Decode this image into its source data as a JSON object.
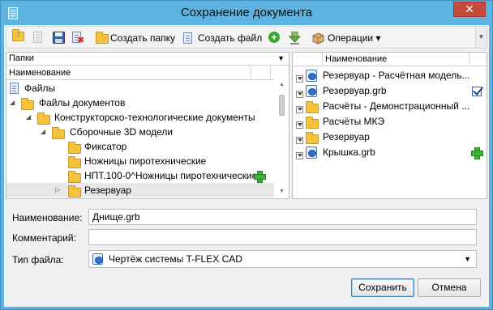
{
  "window": {
    "title": "Сохранение документа",
    "close_glyph": "✕"
  },
  "toolbar": {
    "create_folder_label": "Создать папку",
    "create_file_label": "Создать файл",
    "operations_label": "Операции",
    "operations_arrow": "▾",
    "overflow_glyph": "▼"
  },
  "folders_panel": {
    "header": "Папки",
    "header_arrow": "▼",
    "column": "Наименование",
    "tree": [
      {
        "label": "Файлы",
        "icon": "document-icon",
        "arrow": ""
      },
      {
        "label": "Файлы документов",
        "icon": "folder-icon",
        "arrow": "◢"
      },
      {
        "label": "Конструкторско-технологические документы",
        "icon": "folder-icon",
        "arrow": "◢"
      },
      {
        "label": "Сборочные 3D модели",
        "icon": "folder-icon",
        "arrow": "◢"
      },
      {
        "label": "Фиксатор",
        "icon": "folder-icon",
        "arrow": ""
      },
      {
        "label": "Ножницы пиротехнические",
        "icon": "folder-icon",
        "arrow": ""
      },
      {
        "label": "НПТ.100-0^Ножницы пиротехнические",
        "icon": "folder-icon",
        "arrow": ""
      },
      {
        "label": "Резервуар",
        "icon": "folder-icon",
        "arrow": "▷"
      }
    ]
  },
  "files_panel": {
    "column": "Наименование",
    "rows": [
      {
        "label": "Резервуар - Расчётная модель...",
        "icon": "grb-file-icon",
        "status": ""
      },
      {
        "label": "Резервуар.grb",
        "icon": "grb-file-icon",
        "status": "checked-out-icon"
      },
      {
        "label": "Расчёты - Демонстрационный ...",
        "icon": "folder-icon",
        "status": ""
      },
      {
        "label": "Расчёты МКЭ",
        "icon": "folder-icon",
        "status": ""
      },
      {
        "label": "Резервуар",
        "icon": "folder-icon",
        "status": ""
      },
      {
        "label": "Крышка.grb",
        "icon": "grb-file-icon",
        "status": "new-icon"
      }
    ]
  },
  "form": {
    "name_label": "Наименование:",
    "name_value": "Днище.grb",
    "comment_label": "Комментарий:",
    "comment_value": "",
    "filetype_label": "Тип файла:",
    "filetype_value": "Чертёж системы T-FLEX CAD",
    "filetype_arrow": "▼"
  },
  "buttons": {
    "save_label": "Сохранить",
    "cancel_label": "Отмена"
  },
  "colors": {
    "title_bar": "#5db4e0",
    "close_button": "#c74a3f",
    "folder": "#f5c33b",
    "add_green": "#3cb336"
  }
}
